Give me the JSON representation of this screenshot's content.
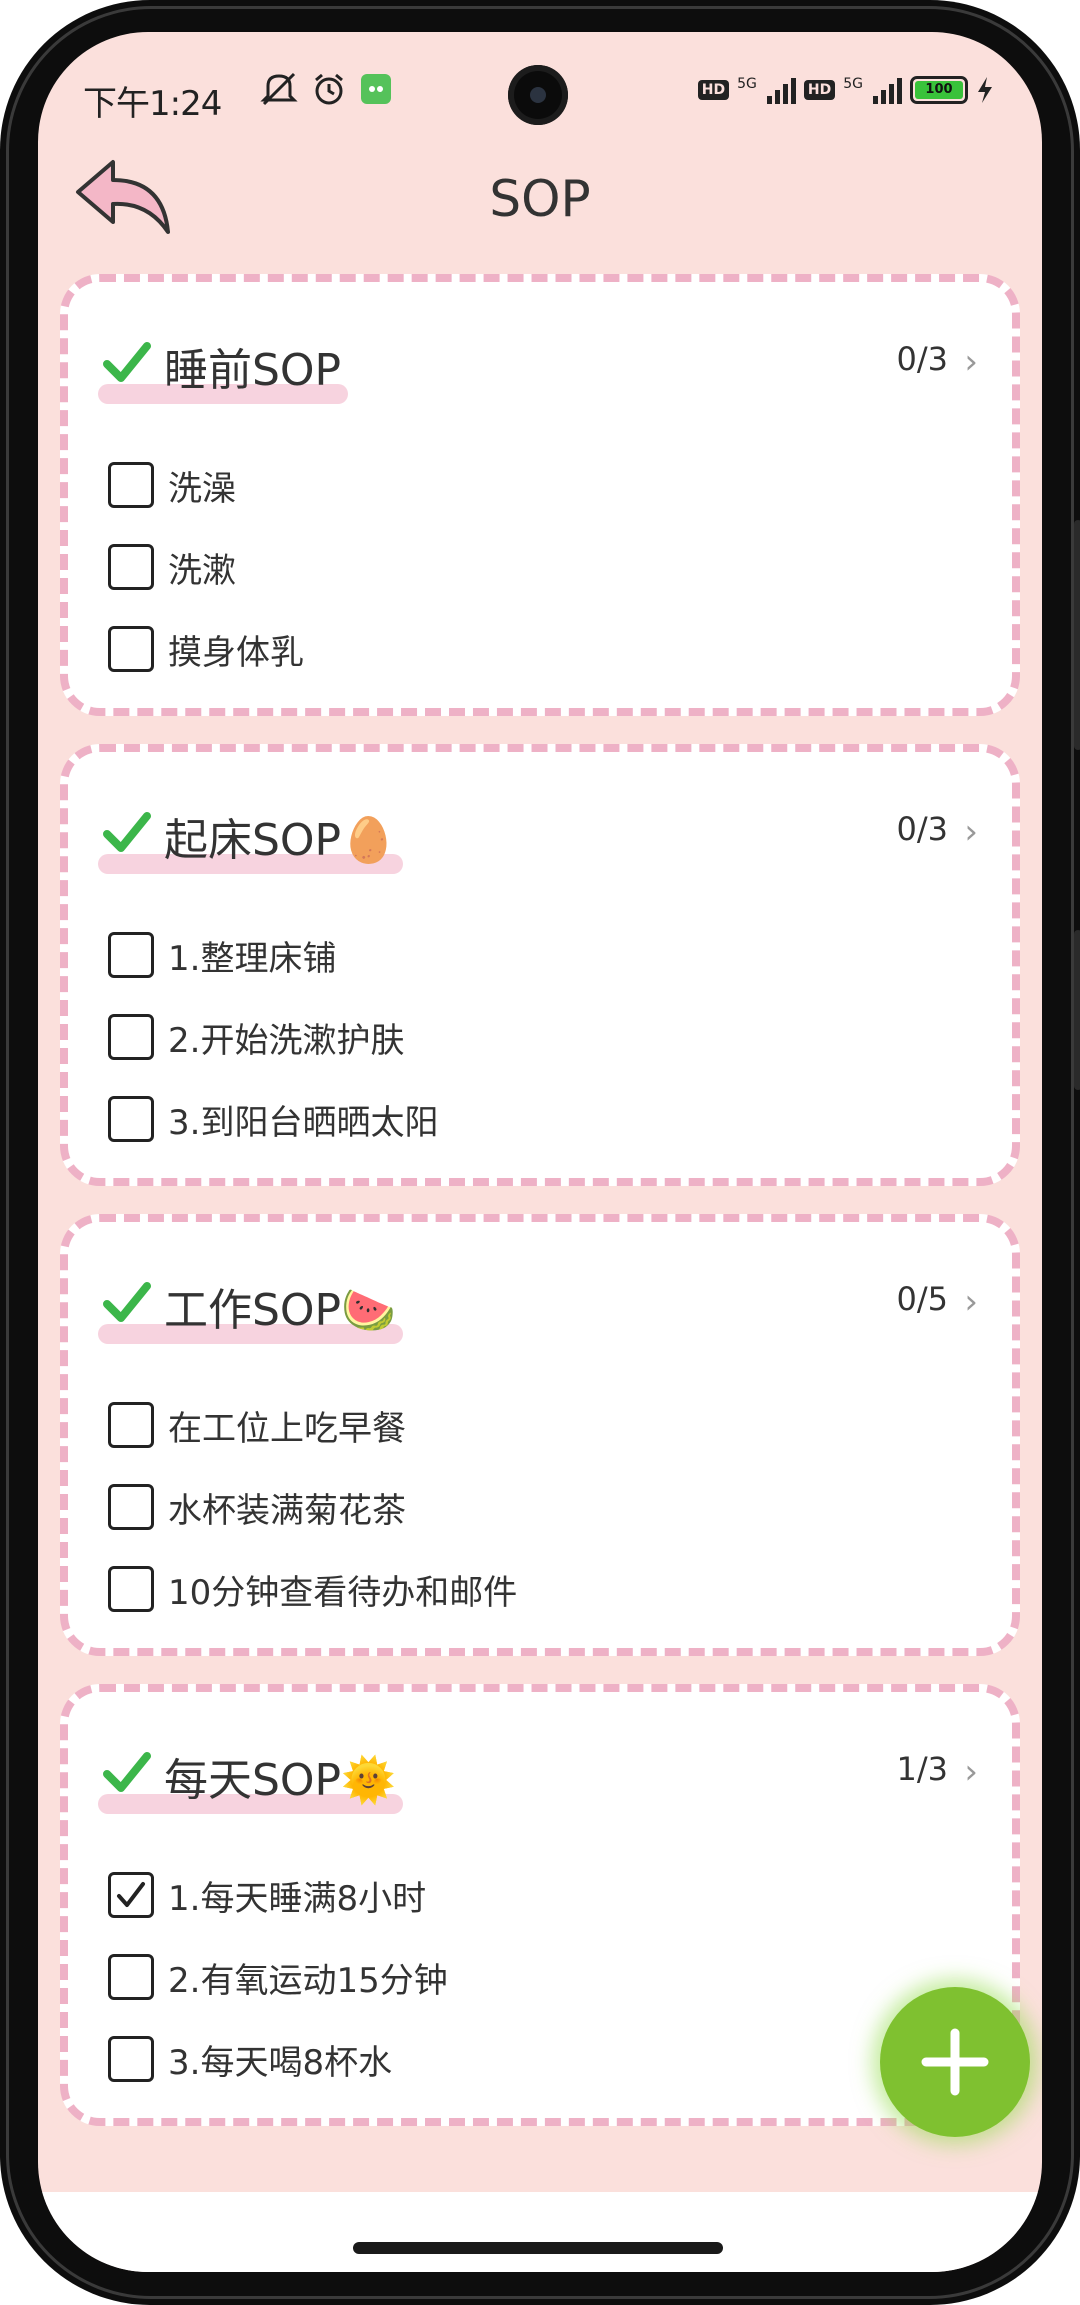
{
  "status": {
    "time": "下午1:24",
    "hd1": "HD",
    "hd2": "HD",
    "net1": "5G",
    "net2": "5G",
    "battery": "100"
  },
  "header": {
    "title": "SOP"
  },
  "cards": [
    {
      "title": "睡前SOP",
      "count": "0/3",
      "items": [
        {
          "label": "洗澡",
          "checked": false
        },
        {
          "label": "洗漱",
          "checked": false
        },
        {
          "label": "摸身体乳",
          "checked": false
        }
      ]
    },
    {
      "title": "起床SOP🥚",
      "count": "0/3",
      "items": [
        {
          "label": "1.整理床铺",
          "checked": false
        },
        {
          "label": "2.开始洗漱护肤",
          "checked": false
        },
        {
          "label": "3.到阳台晒晒太阳",
          "checked": false
        }
      ]
    },
    {
      "title": "工作SOP🍉",
      "count": "0/5",
      "items": [
        {
          "label": "在工位上吃早餐",
          "checked": false
        },
        {
          "label": "水杯装满菊花茶",
          "checked": false
        },
        {
          "label": "10分钟查看待办和邮件",
          "checked": false
        }
      ]
    },
    {
      "title": "每天SOP🌞",
      "count": "1/3",
      "items": [
        {
          "label": "1.每天睡满8小时",
          "checked": true
        },
        {
          "label": "2.有氧运动15分钟",
          "checked": false
        },
        {
          "label": "3.每天喝8杯水",
          "checked": false
        }
      ]
    }
  ],
  "colors": {
    "background": "#fbe0dc",
    "card_border": "#eeb1c6",
    "check_green": "#3cb64a",
    "fab": "#7fc130"
  },
  "icons": {
    "back": "back-arrow-icon",
    "card_check": "checkmark-icon",
    "chevron": "chevron-right-icon",
    "fab": "plus-icon"
  }
}
